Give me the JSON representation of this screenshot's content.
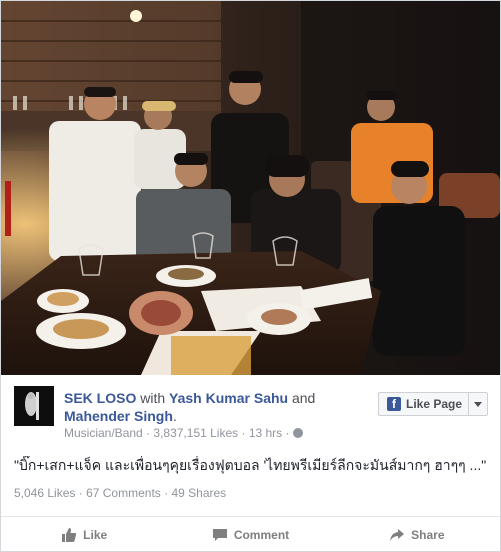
{
  "post": {
    "author": "SEK LOSO",
    "with_word": "with",
    "tag1": "Yash Kumar Sahu",
    "and_word": "and",
    "tag2": "Mahender Singh",
    "period": ".",
    "category": "Musician/Band",
    "likes_meta": "3,837,151 Likes",
    "time": "13 hrs",
    "sep": "·",
    "caption": "\"บิ๊ก+เสก+แจ็ค และเพื่อนๆคุยเรื่องฟุตบอล 'ไทยพรีเมียร์ลีกจะมันส์มากๆ ฮาๆๆ ...\""
  },
  "like_page": {
    "label": "Like Page",
    "icon": "facebook-f-icon"
  },
  "stats": {
    "likes": "5,046 Likes",
    "comments": "67 Comments",
    "shares": "49 Shares",
    "dot": "·"
  },
  "actions": [
    {
      "label": "Like",
      "icon": "thumbs-up-icon"
    },
    {
      "label": "Comment",
      "icon": "comment-icon"
    },
    {
      "label": "Share",
      "icon": "share-icon"
    }
  ],
  "colors": {
    "link": "#3b5998",
    "muted": "#90949c",
    "text": "#1d2129"
  }
}
